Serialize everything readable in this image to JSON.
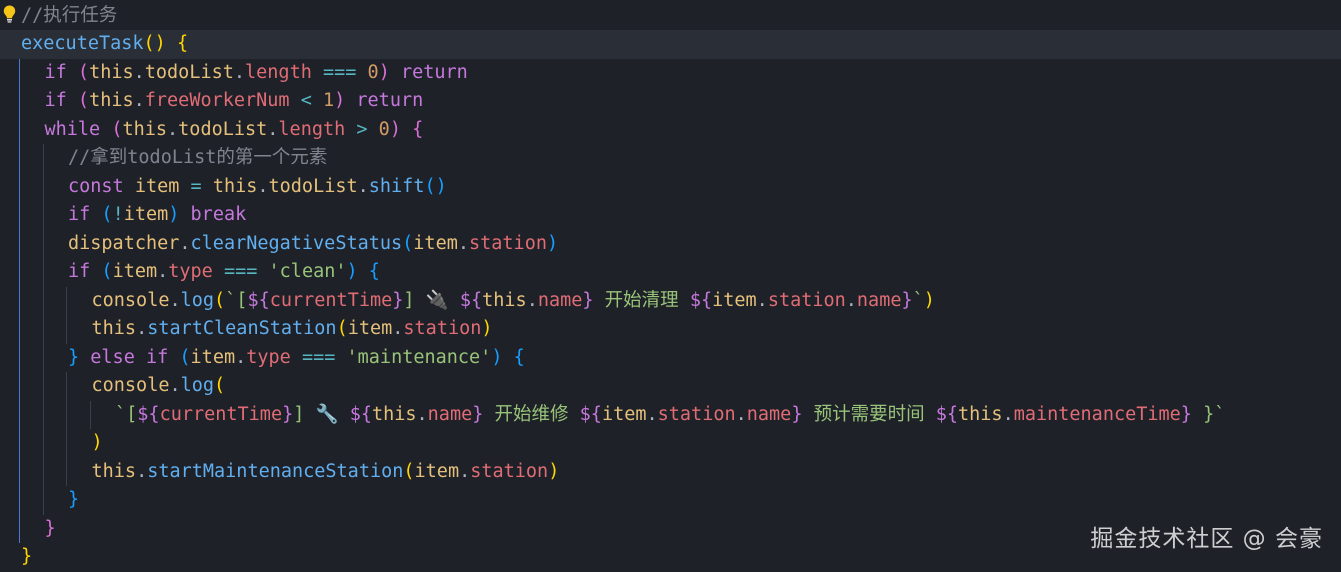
{
  "editor": {
    "lines": [
      {
        "indent": 0,
        "tokens": [
          {
            "t": "//执行任务",
            "c": "c"
          }
        ]
      },
      {
        "indent": 0,
        "current": true,
        "tokens": [
          {
            "t": "executeTask",
            "c": "f"
          },
          {
            "t": "() ",
            "c": "y"
          },
          {
            "t": "{",
            "c": "y"
          }
        ]
      },
      {
        "indent": 1,
        "tokens": [
          {
            "t": "if ",
            "c": "k"
          },
          {
            "t": "(",
            "c": "v"
          },
          {
            "t": "this",
            "c": "w"
          },
          {
            "t": ".",
            "c": "x"
          },
          {
            "t": "todoList",
            "c": "w"
          },
          {
            "t": ".",
            "c": "x"
          },
          {
            "t": "length",
            "c": "p"
          },
          {
            "t": " === ",
            "c": "q"
          },
          {
            "t": "0",
            "c": "n"
          },
          {
            "t": ")",
            "c": "v"
          },
          {
            "t": " return",
            "c": "k"
          }
        ]
      },
      {
        "indent": 1,
        "tokens": [
          {
            "t": "if ",
            "c": "k"
          },
          {
            "t": "(",
            "c": "v"
          },
          {
            "t": "this",
            "c": "w"
          },
          {
            "t": ".",
            "c": "x"
          },
          {
            "t": "freeWorkerNum",
            "c": "p"
          },
          {
            "t": " < ",
            "c": "q"
          },
          {
            "t": "1",
            "c": "n"
          },
          {
            "t": ")",
            "c": "v"
          },
          {
            "t": " return",
            "c": "k"
          }
        ]
      },
      {
        "indent": 1,
        "tokens": [
          {
            "t": "while ",
            "c": "k"
          },
          {
            "t": "(",
            "c": "v"
          },
          {
            "t": "this",
            "c": "w"
          },
          {
            "t": ".",
            "c": "x"
          },
          {
            "t": "todoList",
            "c": "w"
          },
          {
            "t": ".",
            "c": "x"
          },
          {
            "t": "length",
            "c": "p"
          },
          {
            "t": " > ",
            "c": "q"
          },
          {
            "t": "0",
            "c": "n"
          },
          {
            "t": ") ",
            "c": "v"
          },
          {
            "t": "{",
            "c": "v"
          }
        ]
      },
      {
        "indent": 2,
        "tokens": [
          {
            "t": "//拿到todoList的第一个元素",
            "c": "c"
          }
        ]
      },
      {
        "indent": 2,
        "tokens": [
          {
            "t": "const ",
            "c": "k"
          },
          {
            "t": "item",
            "c": "w"
          },
          {
            "t": " = ",
            "c": "q"
          },
          {
            "t": "this",
            "c": "w"
          },
          {
            "t": ".",
            "c": "x"
          },
          {
            "t": "todoList",
            "c": "w"
          },
          {
            "t": ".",
            "c": "x"
          },
          {
            "t": "shift",
            "c": "f"
          },
          {
            "t": "()",
            "c": "b"
          }
        ]
      },
      {
        "indent": 2,
        "tokens": [
          {
            "t": "if ",
            "c": "k"
          },
          {
            "t": "(",
            "c": "b"
          },
          {
            "t": "!",
            "c": "q"
          },
          {
            "t": "item",
            "c": "w"
          },
          {
            "t": ")",
            "c": "b"
          },
          {
            "t": " break",
            "c": "k"
          }
        ]
      },
      {
        "indent": 2,
        "tokens": [
          {
            "t": "dispatcher",
            "c": "w"
          },
          {
            "t": ".",
            "c": "x"
          },
          {
            "t": "clearNegativeStatus",
            "c": "f"
          },
          {
            "t": "(",
            "c": "b"
          },
          {
            "t": "item",
            "c": "w"
          },
          {
            "t": ".",
            "c": "x"
          },
          {
            "t": "station",
            "c": "p"
          },
          {
            "t": ")",
            "c": "b"
          }
        ]
      },
      {
        "indent": 2,
        "tokens": [
          {
            "t": "if ",
            "c": "k"
          },
          {
            "t": "(",
            "c": "b"
          },
          {
            "t": "item",
            "c": "w"
          },
          {
            "t": ".",
            "c": "x"
          },
          {
            "t": "type",
            "c": "p"
          },
          {
            "t": " === ",
            "c": "q"
          },
          {
            "t": "'clean'",
            "c": "s"
          },
          {
            "t": ") ",
            "c": "b"
          },
          {
            "t": "{",
            "c": "b"
          }
        ]
      },
      {
        "indent": 3,
        "tokens": [
          {
            "t": "console",
            "c": "w"
          },
          {
            "t": ".",
            "c": "x"
          },
          {
            "t": "log",
            "c": "f"
          },
          {
            "t": "(",
            "c": "y"
          },
          {
            "t": "`[",
            "c": "s"
          },
          {
            "t": "${",
            "c": "k"
          },
          {
            "t": "currentTime",
            "c": "p"
          },
          {
            "t": "}",
            "c": "k"
          },
          {
            "t": "] 🔌 ",
            "c": "s"
          },
          {
            "t": "${",
            "c": "k"
          },
          {
            "t": "this",
            "c": "w"
          },
          {
            "t": ".",
            "c": "x"
          },
          {
            "t": "name",
            "c": "p"
          },
          {
            "t": "}",
            "c": "k"
          },
          {
            "t": " 开始清理 ",
            "c": "s"
          },
          {
            "t": "${",
            "c": "k"
          },
          {
            "t": "item",
            "c": "w"
          },
          {
            "t": ".",
            "c": "x"
          },
          {
            "t": "station",
            "c": "p"
          },
          {
            "t": ".",
            "c": "x"
          },
          {
            "t": "name",
            "c": "p"
          },
          {
            "t": "}",
            "c": "k"
          },
          {
            "t": "`",
            "c": "s"
          },
          {
            "t": ")",
            "c": "y"
          }
        ]
      },
      {
        "indent": 3,
        "tokens": [
          {
            "t": "this",
            "c": "w"
          },
          {
            "t": ".",
            "c": "x"
          },
          {
            "t": "startCleanStation",
            "c": "f"
          },
          {
            "t": "(",
            "c": "y"
          },
          {
            "t": "item",
            "c": "w"
          },
          {
            "t": ".",
            "c": "x"
          },
          {
            "t": "station",
            "c": "p"
          },
          {
            "t": ")",
            "c": "y"
          }
        ]
      },
      {
        "indent": 2,
        "tokens": [
          {
            "t": "} ",
            "c": "b"
          },
          {
            "t": "else ",
            "c": "k"
          },
          {
            "t": "if ",
            "c": "k"
          },
          {
            "t": "(",
            "c": "b"
          },
          {
            "t": "item",
            "c": "w"
          },
          {
            "t": ".",
            "c": "x"
          },
          {
            "t": "type",
            "c": "p"
          },
          {
            "t": " === ",
            "c": "q"
          },
          {
            "t": "'maintenance'",
            "c": "s"
          },
          {
            "t": ") ",
            "c": "b"
          },
          {
            "t": "{",
            "c": "b"
          }
        ]
      },
      {
        "indent": 3,
        "tokens": [
          {
            "t": "console",
            "c": "w"
          },
          {
            "t": ".",
            "c": "x"
          },
          {
            "t": "log",
            "c": "f"
          },
          {
            "t": "(",
            "c": "y"
          }
        ]
      },
      {
        "indent": 4,
        "tokens": [
          {
            "t": "`[",
            "c": "s"
          },
          {
            "t": "${",
            "c": "k"
          },
          {
            "t": "currentTime",
            "c": "p"
          },
          {
            "t": "}",
            "c": "k"
          },
          {
            "t": "] 🔧 ",
            "c": "s"
          },
          {
            "t": "${",
            "c": "k"
          },
          {
            "t": "this",
            "c": "w"
          },
          {
            "t": ".",
            "c": "x"
          },
          {
            "t": "name",
            "c": "p"
          },
          {
            "t": "}",
            "c": "k"
          },
          {
            "t": " 开始维修 ",
            "c": "s"
          },
          {
            "t": "${",
            "c": "k"
          },
          {
            "t": "item",
            "c": "w"
          },
          {
            "t": ".",
            "c": "x"
          },
          {
            "t": "station",
            "c": "p"
          },
          {
            "t": ".",
            "c": "x"
          },
          {
            "t": "name",
            "c": "p"
          },
          {
            "t": "}",
            "c": "k"
          },
          {
            "t": " 预计需要时间 ",
            "c": "s"
          },
          {
            "t": "${",
            "c": "k"
          },
          {
            "t": "this",
            "c": "w"
          },
          {
            "t": ".",
            "c": "x"
          },
          {
            "t": "maintenanceTime",
            "c": "p"
          },
          {
            "t": "}",
            "c": "k"
          },
          {
            "t": " }`",
            "c": "s"
          }
        ]
      },
      {
        "indent": 3,
        "tokens": [
          {
            "t": ")",
            "c": "y"
          }
        ]
      },
      {
        "indent": 3,
        "tokens": [
          {
            "t": "this",
            "c": "w"
          },
          {
            "t": ".",
            "c": "x"
          },
          {
            "t": "startMaintenanceStation",
            "c": "f"
          },
          {
            "t": "(",
            "c": "y"
          },
          {
            "t": "item",
            "c": "w"
          },
          {
            "t": ".",
            "c": "x"
          },
          {
            "t": "station",
            "c": "p"
          },
          {
            "t": ")",
            "c": "y"
          }
        ]
      },
      {
        "indent": 2,
        "tokens": [
          {
            "t": "}",
            "c": "b"
          }
        ]
      },
      {
        "indent": 1,
        "tokens": [
          {
            "t": "}",
            "c": "v"
          }
        ]
      },
      {
        "indent": 0,
        "tokens": [
          {
            "t": "}",
            "c": "y"
          }
        ]
      }
    ]
  },
  "watermark": "掘金技术社区 @ 会豪",
  "icons": {
    "gutter": "lightbulb-icon"
  },
  "colors": {
    "background": "#1e2128",
    "current_line": "#2a2e37",
    "keyword": "#c678dd",
    "function": "#61afef",
    "property": "#e06c75",
    "number": "#d19a66",
    "string": "#98c379",
    "comment": "#7f848e"
  }
}
